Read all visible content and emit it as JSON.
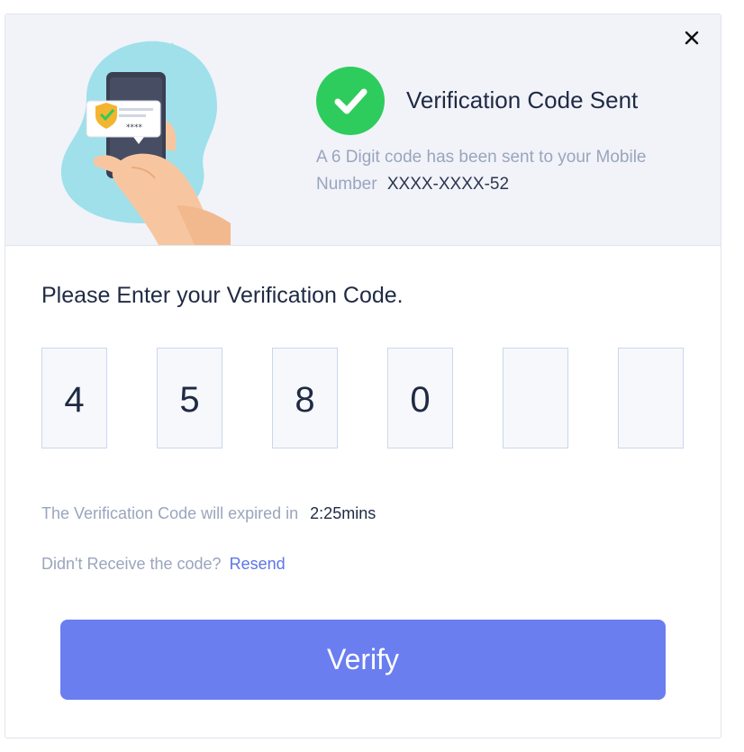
{
  "header": {
    "close_icon": "close-icon",
    "illustration_icon": "phone-verification-illustration",
    "status_icon": "check-icon",
    "title": "Verification Code Sent",
    "description": "A 6 Digit code has been sent to your Mobile Number",
    "masked_number": "XXXX-XXXX-52",
    "phone_code_display": "****",
    "accent_color": "#2ecc5c"
  },
  "form": {
    "prompt": "Please Enter your Verification Code.",
    "digits": [
      "4",
      "5",
      "8",
      "0",
      "",
      ""
    ],
    "expiry_label": "The Verification Code will expired in",
    "expiry_time": "2:25mins",
    "resend_prompt": "Didn't Receive the code?",
    "resend_link": "Resend",
    "verify_label": "Verify",
    "button_color": "#6a7ef0"
  }
}
